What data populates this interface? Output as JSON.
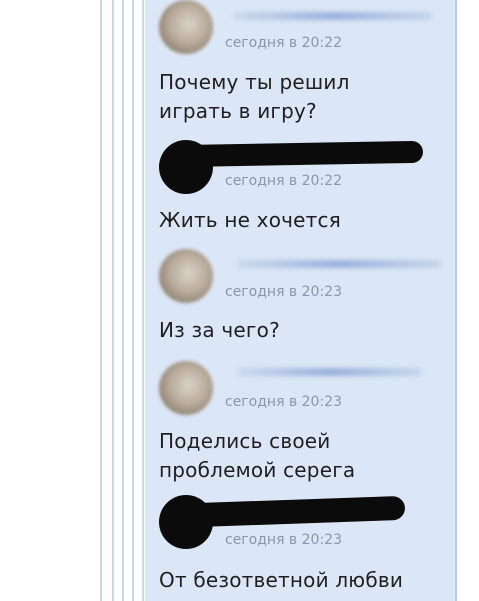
{
  "messages": [
    {
      "redacted_author": false,
      "timestamp": "сегодня в 20:22",
      "text_lines": [
        "Почему ты решил",
        "играть в игру?"
      ]
    },
    {
      "redacted_author": true,
      "timestamp": "сегодня в 20:22",
      "text_lines": [
        "Жить не хочется"
      ]
    },
    {
      "redacted_author": false,
      "timestamp": "сегодня в 20:23",
      "text_lines": [
        "Из за чего?"
      ]
    },
    {
      "redacted_author": false,
      "timestamp": "сегодня в 20:23",
      "text_lines": [
        "Поделись своей",
        "проблемой серега"
      ]
    },
    {
      "redacted_author": true,
      "timestamp": "сегодня в 20:23",
      "text_lines": [
        "От безответной любви"
      ]
    }
  ],
  "colors": {
    "panel_background": "#dbe6f6",
    "timestamp": "#8a97ab",
    "message_text": "#1f1f1f",
    "guide_lines": "#c9d8ee"
  }
}
